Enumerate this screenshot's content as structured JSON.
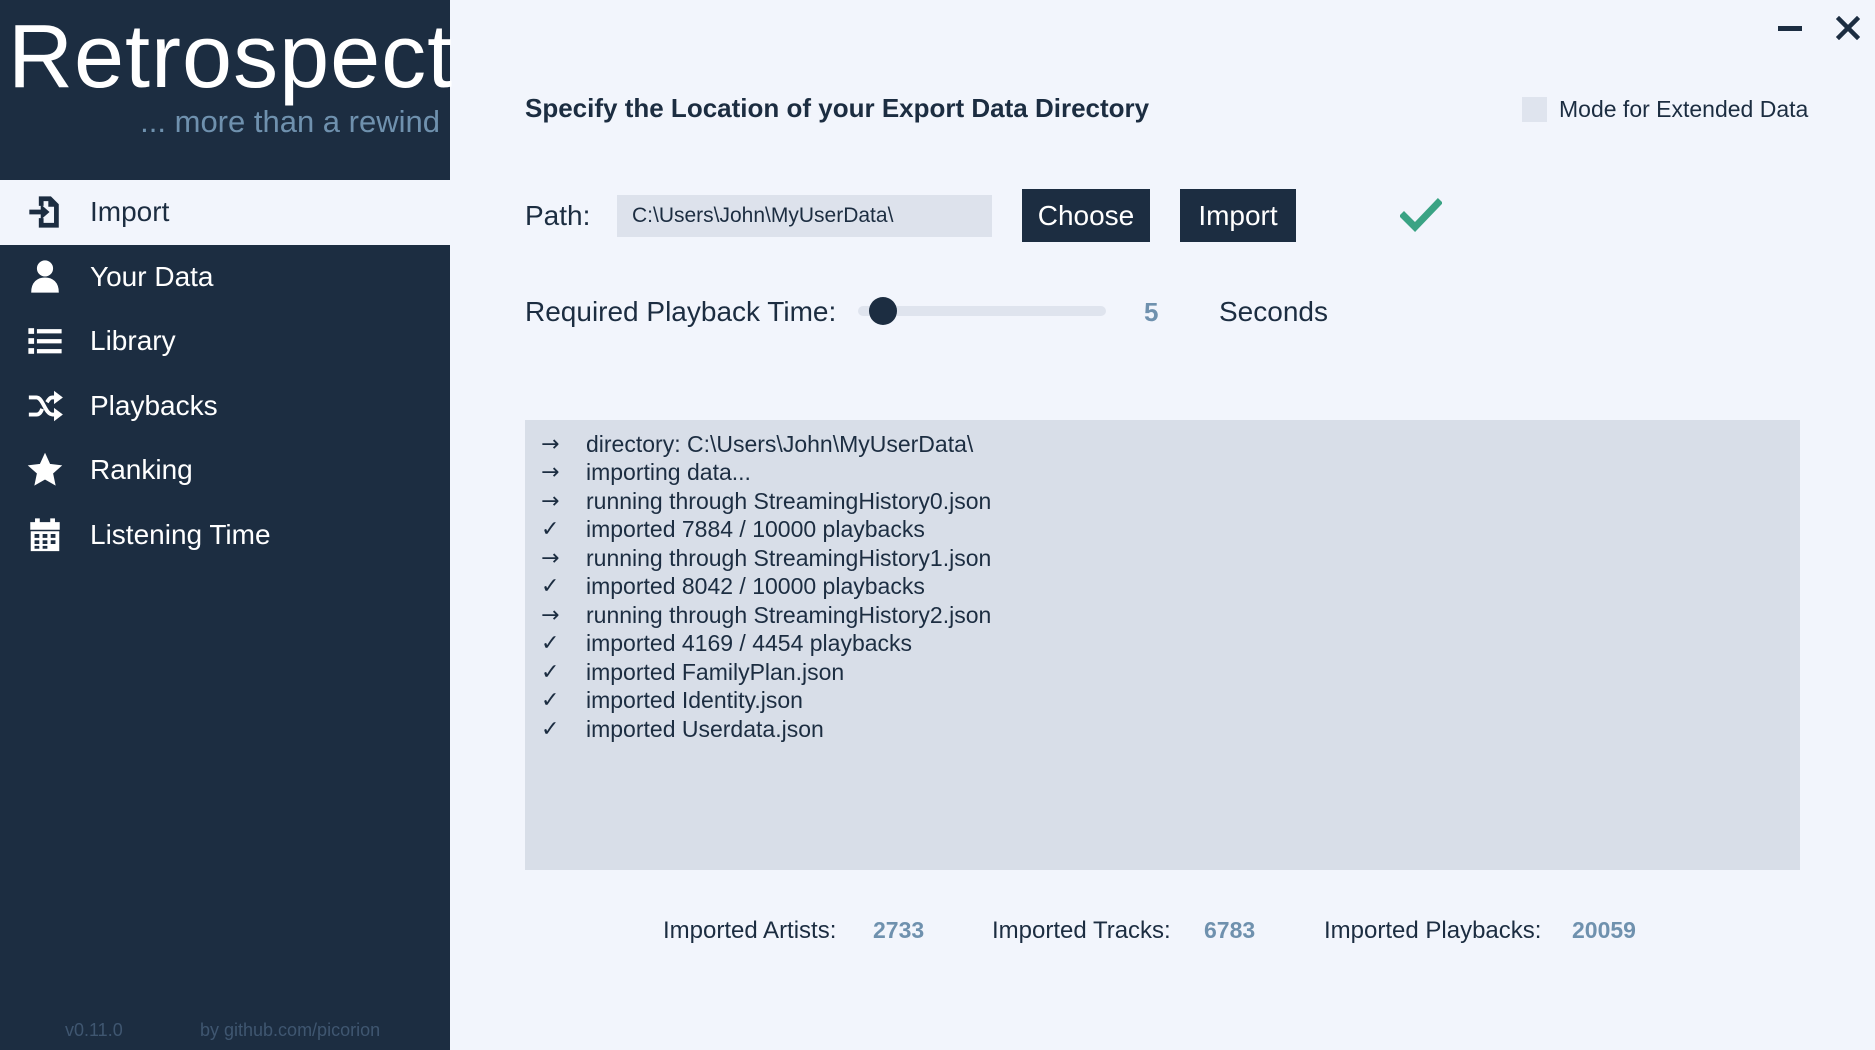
{
  "brand": {
    "title": "Retrospect",
    "tagline": "... more than a rewind"
  },
  "sidebar": {
    "items": [
      {
        "label": "Import",
        "icon": "file-import-icon",
        "active": true
      },
      {
        "label": "Your Data",
        "icon": "user-icon",
        "active": false
      },
      {
        "label": "Library",
        "icon": "list-icon",
        "active": false
      },
      {
        "label": "Playbacks",
        "icon": "shuffle-icon",
        "active": false
      },
      {
        "label": "Ranking",
        "icon": "star-icon",
        "active": false
      },
      {
        "label": "Listening Time",
        "icon": "calendar-icon",
        "active": false
      }
    ],
    "version": "v0.11.0",
    "credit": "by github.com/picorion"
  },
  "main": {
    "heading": "Specify the Location of your Export Data Directory",
    "extended_mode": {
      "label": "Mode for Extended Data",
      "checked": false
    },
    "path": {
      "label": "Path:",
      "value": "C:\\Users\\John\\MyUserData\\"
    },
    "choose_label": "Choose",
    "import_label": "Import",
    "status_icon": "checkmark-icon",
    "playback": {
      "label": "Required Playback Time:",
      "value": "5",
      "unit": "Seconds",
      "slider_fraction": 0.1
    },
    "log": [
      {
        "symbol": "→",
        "text": "directory: C:\\Users\\John\\MyUserData\\"
      },
      {
        "symbol": "→",
        "text": "importing data..."
      },
      {
        "symbol": "→",
        "text": "running through StreamingHistory0.json"
      },
      {
        "symbol": "✓",
        "text": "imported 7884 / 10000 playbacks"
      },
      {
        "symbol": "→",
        "text": "running through StreamingHistory1.json"
      },
      {
        "symbol": "✓",
        "text": "imported 8042 / 10000 playbacks"
      },
      {
        "symbol": "→",
        "text": "running through StreamingHistory2.json"
      },
      {
        "symbol": "✓",
        "text": "imported 4169 / 4454 playbacks"
      },
      {
        "symbol": "✓",
        "text": "imported FamilyPlan.json"
      },
      {
        "symbol": "✓",
        "text": "imported Identity.json"
      },
      {
        "symbol": "✓",
        "text": "imported Userdata.json"
      }
    ],
    "stats": {
      "artists_label": "Imported Artists:",
      "artists_value": "2733",
      "tracks_label": "Imported Tracks:",
      "tracks_value": "6783",
      "playbacks_label": "Imported Playbacks:",
      "playbacks_value": "20059"
    }
  },
  "colors": {
    "sidebar_bg": "#1c2d41",
    "page_bg": "#f2f5fc",
    "accent": "#6f91ae",
    "success": "#3aa384"
  }
}
